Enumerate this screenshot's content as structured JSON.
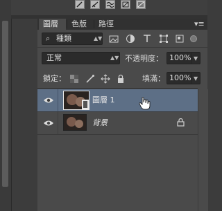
{
  "tabs": [
    "圖層",
    "色版",
    "路徑"
  ],
  "panel_menu_icon": "panel-menu-icon",
  "filter": {
    "value": "種類",
    "icons": [
      "image-filter-icon",
      "adjustment-filter-icon",
      "type-filter-icon",
      "shape-filter-icon",
      "smart-object-filter-icon"
    ]
  },
  "blend": {
    "mode": "正常",
    "opacity_label": "不透明度：",
    "opacity_value": "100%"
  },
  "lock": {
    "label": "鎖定：",
    "fill_label": "填滿：",
    "fill_value": "100%"
  },
  "layers": [
    {
      "name": "圖層 1",
      "selected": true,
      "visible": true,
      "locked": false
    },
    {
      "name": "背景",
      "selected": false,
      "visible": true,
      "locked": true,
      "italic": true
    }
  ],
  "colors": {
    "selection": "#5d6f86",
    "panel": "#4a4a4a",
    "field": "#2b2b2b"
  }
}
